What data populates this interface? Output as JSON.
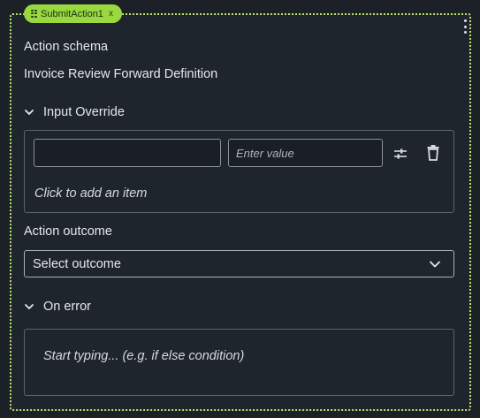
{
  "node": {
    "tag_label": "SubmitAction1",
    "tag_close": "x"
  },
  "schema": {
    "label": "Action schema",
    "value": "Invoice Review Forward Definition"
  },
  "input_override": {
    "title": "Input Override",
    "key_value": "",
    "value_placeholder": "Enter value",
    "add_item_label": "Click to add an item"
  },
  "outcome": {
    "label": "Action outcome",
    "selected": "Select outcome"
  },
  "on_error": {
    "title": "On error",
    "placeholder": "Start typing... (e.g. if else condition)"
  },
  "colors": {
    "accent": "#9ad83f",
    "background": "#1f252c"
  }
}
